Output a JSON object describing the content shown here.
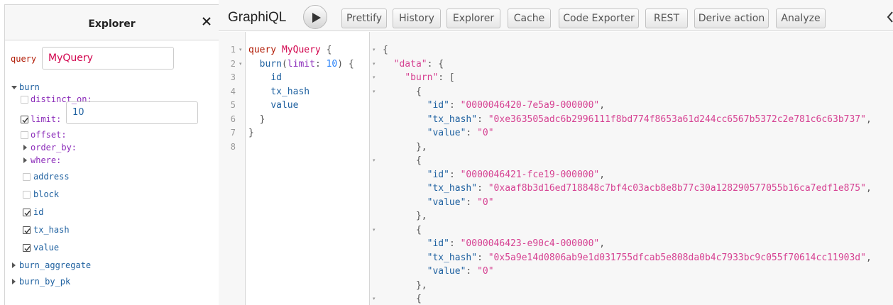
{
  "explorer": {
    "title": "Explorer",
    "operation_keyword": "query",
    "operation_name": "MyQuery",
    "tree": {
      "root_field": "burn",
      "args": [
        {
          "name": "distinct_on:",
          "checked": false,
          "expandable": false
        },
        {
          "name": "limit:",
          "checked": true,
          "expandable": false,
          "value": "10"
        },
        {
          "name": "offset:",
          "checked": false,
          "expandable": false
        },
        {
          "name": "order_by:",
          "checked": false,
          "expandable": true
        },
        {
          "name": "where:",
          "checked": false,
          "expandable": true
        }
      ],
      "fields": [
        {
          "name": "address",
          "checked": false
        },
        {
          "name": "block",
          "checked": false
        },
        {
          "name": "id",
          "checked": true
        },
        {
          "name": "tx_hash",
          "checked": true
        },
        {
          "name": "value",
          "checked": true
        }
      ],
      "other_roots": [
        "burn_aggregate",
        "burn_by_pk"
      ]
    }
  },
  "toolbar": {
    "title": "GraphiQL",
    "buttons": [
      "Prettify",
      "History",
      "Explorer",
      "Cache",
      "Code Exporter",
      "REST",
      "Derive action",
      "Analyze"
    ]
  },
  "query_editor": {
    "line_numbers": [
      "1",
      "2",
      "3",
      "4",
      "5",
      "6",
      "7",
      "8"
    ],
    "keyword": "query",
    "op_name": "MyQuery",
    "field": "burn",
    "arg_name": "limit",
    "arg_value": "10",
    "selections": [
      "id",
      "tx_hash",
      "value"
    ]
  },
  "result": {
    "data_key": "\"data\"",
    "list_key": "\"burn\"",
    "items": [
      {
        "id": "\"0000046420-7e5a9-000000\"",
        "tx_hash": "\"0xe363505adc6b2996111f8bd774f8653a61d244cc6567b5372c2e781c6c63b737\"",
        "value": "\"0\""
      },
      {
        "id": "\"0000046421-fce19-000000\"",
        "tx_hash": "\"0xaaf8b3d16ed718848c7bf4c03acb8e8b77c30a128290577055b16ca7edf1e875\"",
        "value": "\"0\""
      },
      {
        "id": "\"0000046423-e90c4-000000\"",
        "tx_hash": "\"0x5a9e14d0806ab9e1d031755dfcab5e808da0b4c7933bc9c055f70614cc11903d\"",
        "value": "\"0\""
      }
    ],
    "key_id": "\"id\"",
    "key_tx_hash": "\"tx_hash\"",
    "key_value": "\"value\""
  },
  "icons": {
    "close": "close-icon",
    "execute": "play-icon",
    "checkbox": "checkbox-icon",
    "expand": "triangle-icon",
    "more": "chevron-left-icon"
  }
}
